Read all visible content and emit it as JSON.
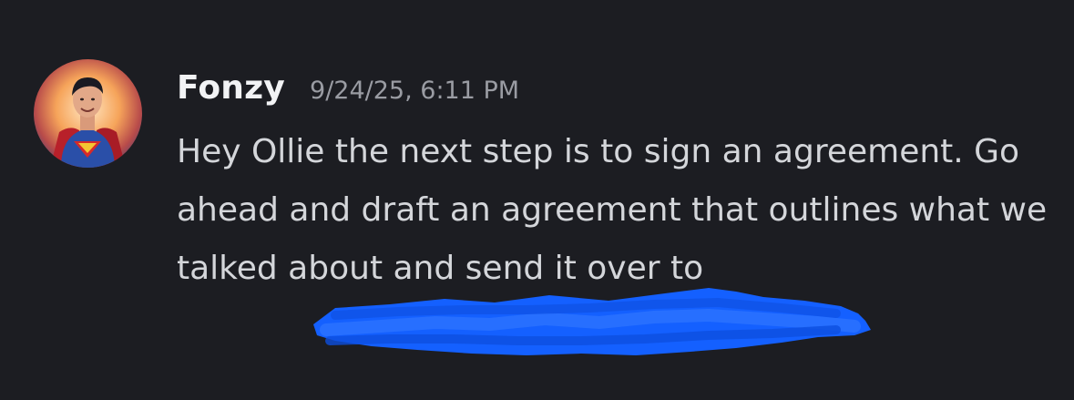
{
  "message": {
    "author": "Fonzy",
    "timestamp": "9/24/25, 6:11 PM",
    "text": "Hey Ollie the next step is to sign an agreement. Go ahead and draft an agreement that outlines what we talked about and send it over to",
    "avatar_icon": "user-avatar-icon",
    "redaction_color": "#1460ff"
  }
}
